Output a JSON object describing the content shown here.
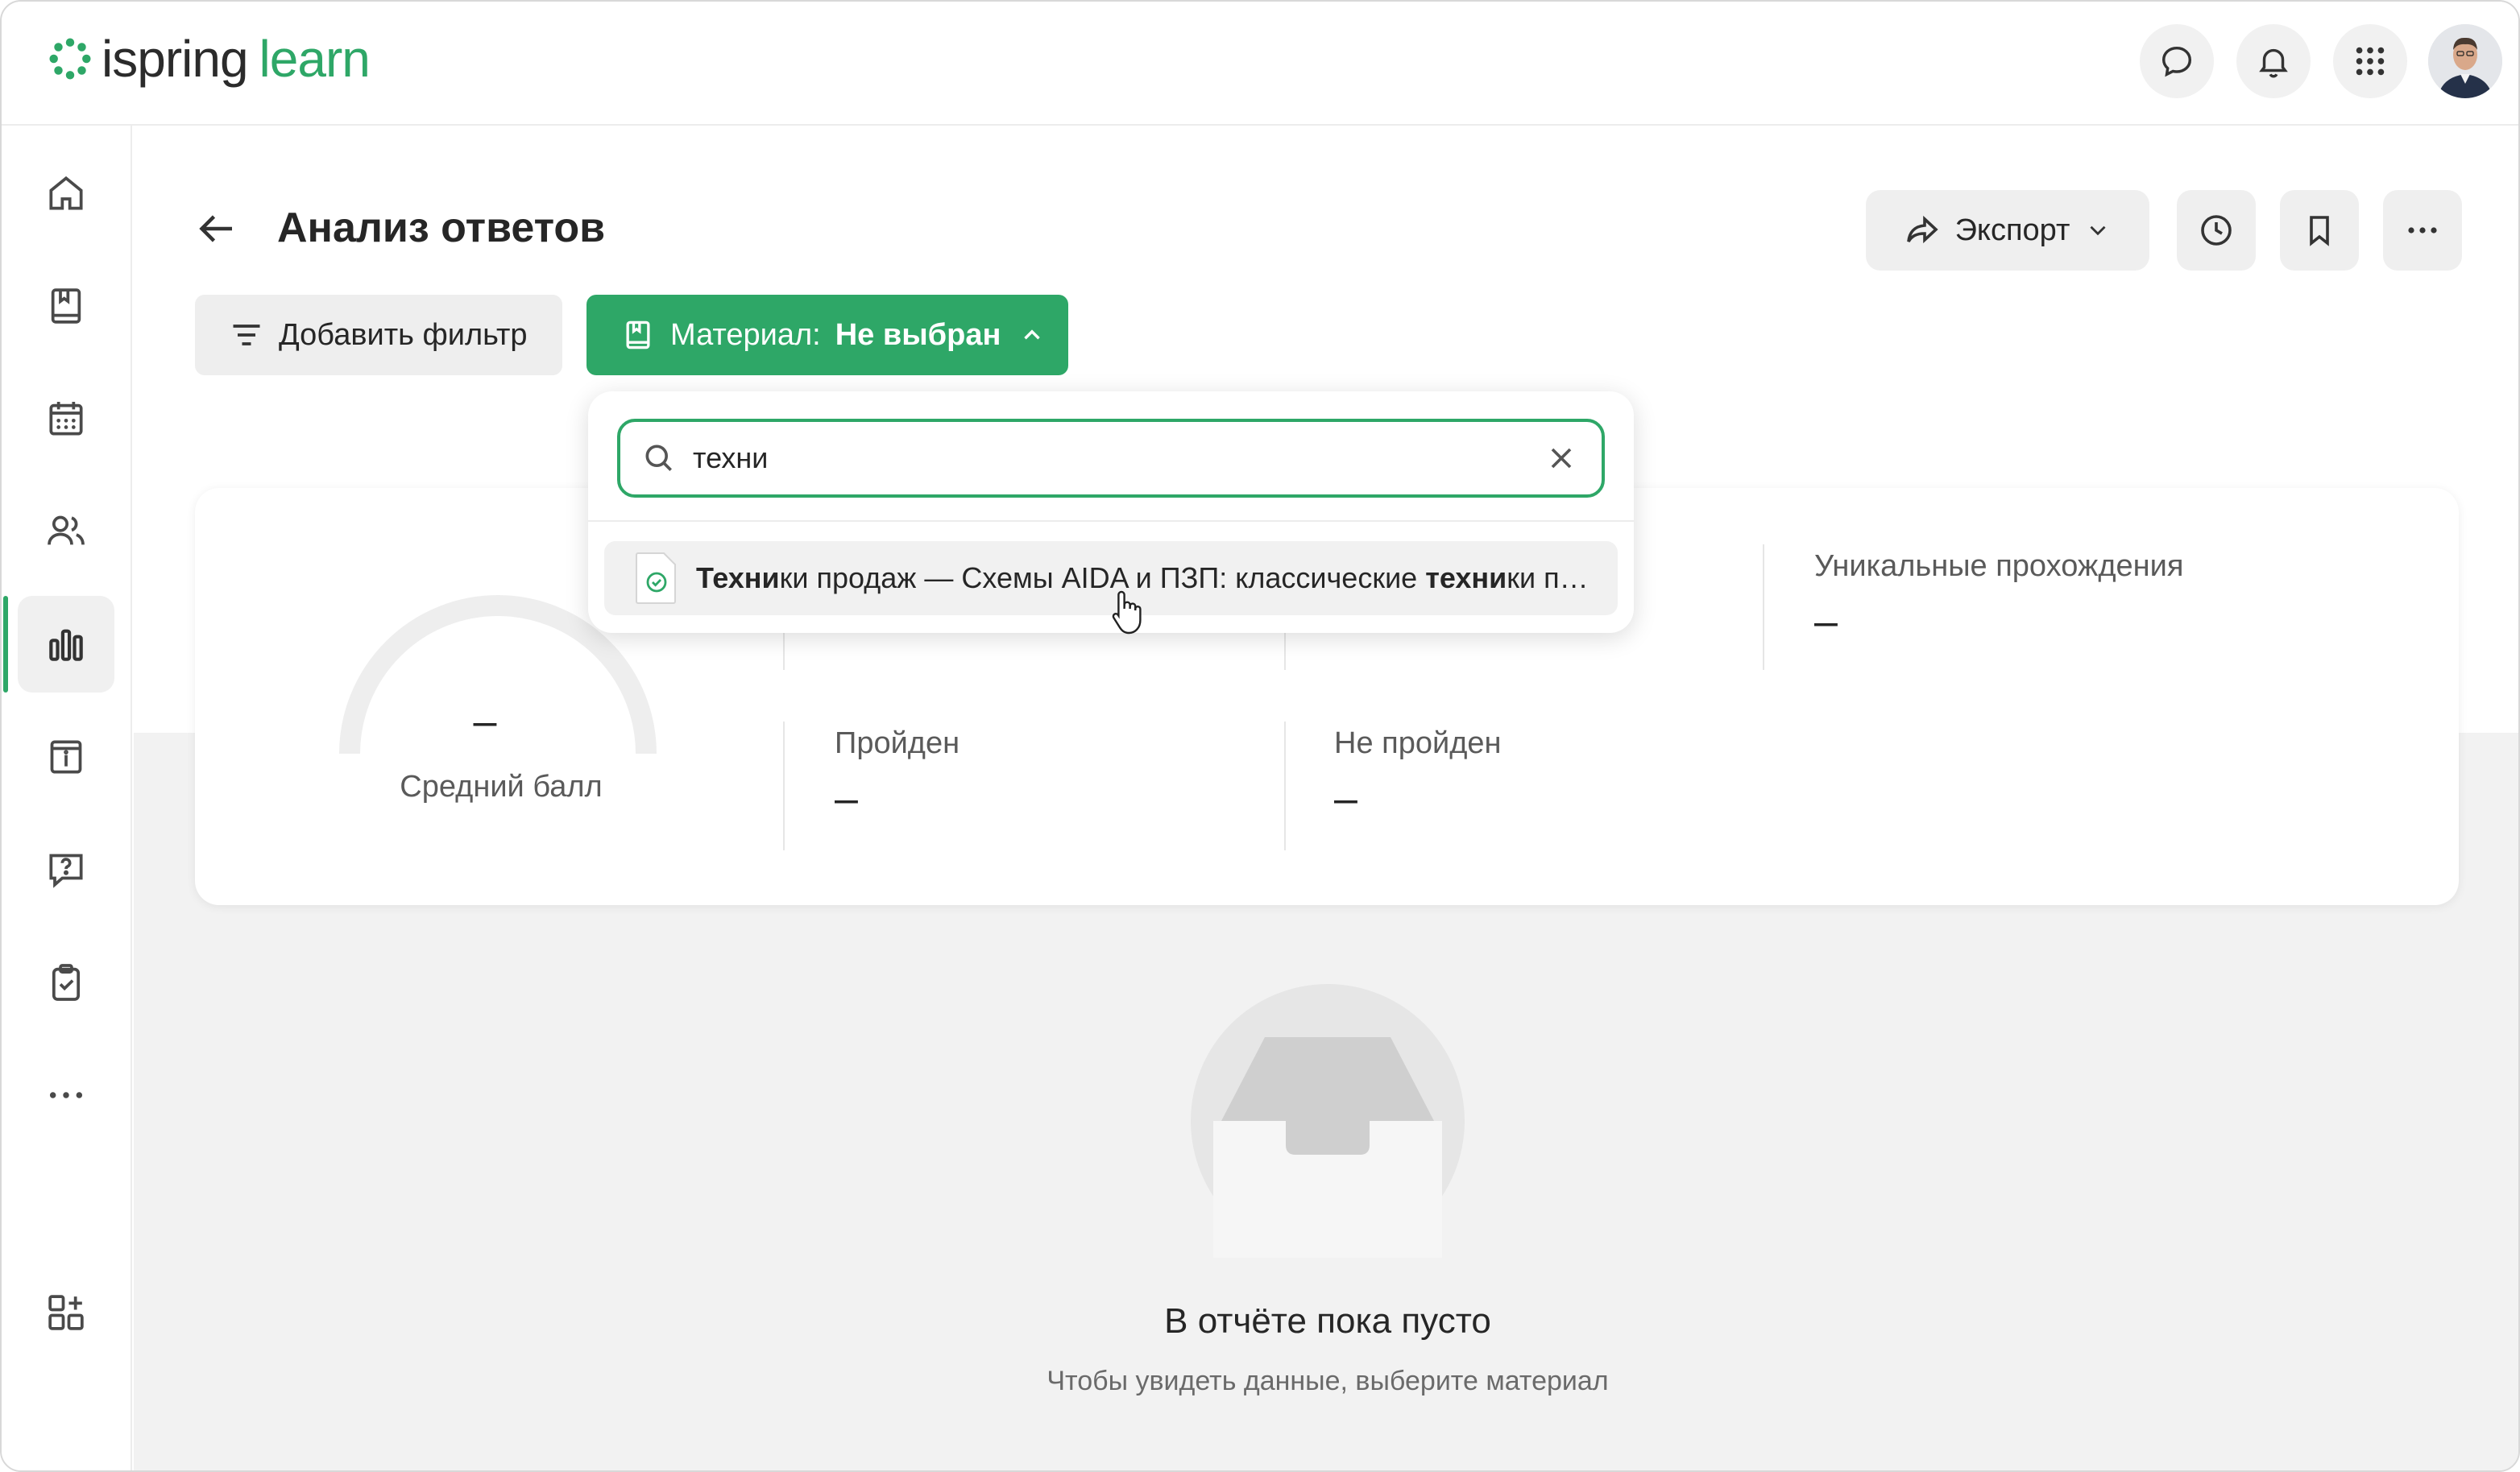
{
  "app": {
    "logo_part1": "ispring",
    "logo_part2": "learn",
    "brand_color": "#2ea767"
  },
  "header": {
    "icons": [
      "chat-icon",
      "bell-icon",
      "apps-grid-icon"
    ],
    "avatar": "user-avatar"
  },
  "sidebar": {
    "items": [
      {
        "icon": "home-icon",
        "active": false
      },
      {
        "icon": "book-icon",
        "active": false
      },
      {
        "icon": "calendar-icon",
        "active": false
      },
      {
        "icon": "users-icon",
        "active": false
      },
      {
        "icon": "bar-chart-icon",
        "active": true
      },
      {
        "icon": "info-board-icon",
        "active": false
      },
      {
        "icon": "question-icon",
        "active": false
      },
      {
        "icon": "clipboard-check-icon",
        "active": false
      },
      {
        "icon": "more-icon",
        "active": false
      },
      {
        "icon": "add-widget-icon",
        "active": false
      }
    ]
  },
  "page": {
    "title": "Анализ ответов",
    "export_label": "Экспорт",
    "add_filter_label": "Добавить фильтр",
    "material_label": "Материал:",
    "material_value": "Не выбран"
  },
  "dropdown": {
    "search_value": "техни",
    "result": {
      "bold_prefix": "Техни",
      "middle": "ки продаж — Схемы AIDA и ПЗП: классические ",
      "bold_suffix": "техни",
      "tail": "ки продаж"
    }
  },
  "stats": {
    "average_label": "Средний балл",
    "average_value": "–",
    "unique_label": "Уникальные прохождения",
    "unique_value": "–",
    "hidden1_value": "–",
    "hidden2_value": "–",
    "passed_label": "Пройден",
    "passed_value": "–",
    "failed_label": "Не пройден",
    "failed_value": "–"
  },
  "empty_state": {
    "title": "В отчёте пока пусто",
    "subtitle": "Чтобы увидеть данные, выберите материал"
  }
}
